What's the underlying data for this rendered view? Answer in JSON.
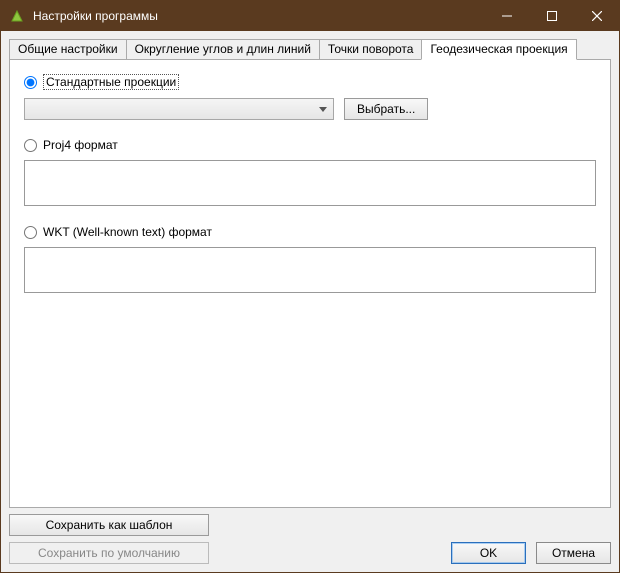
{
  "window": {
    "title": "Настройки программы"
  },
  "tabs": [
    {
      "label": "Общие настройки"
    },
    {
      "label": "Округление углов и длин линий"
    },
    {
      "label": "Точки поворота"
    },
    {
      "label": "Геодезическая проекция"
    }
  ],
  "projection": {
    "standard_label": "Стандартные проекции",
    "select_button": "Выбрать...",
    "proj4_label": "Proj4 формат",
    "proj4_value": "",
    "wkt_label": "WKT (Well-known text) формат",
    "wkt_value": "",
    "combo_value": ""
  },
  "footer": {
    "save_template": "Сохранить как шаблон",
    "save_default": "Сохранить по умолчанию",
    "ok": "OK",
    "cancel": "Отмена"
  }
}
